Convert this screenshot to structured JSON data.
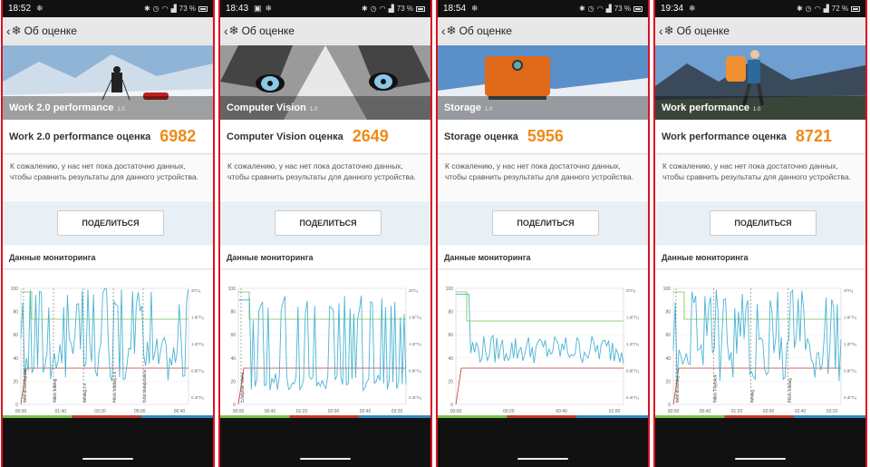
{
  "panels": [
    {
      "time": "18:52",
      "battery": "73 %",
      "appbar_title": "Об оценке",
      "hero_title": "Work 2.0 performance",
      "hero_version": "1.0",
      "score_label": "Work 2.0 performance оценка",
      "score_value": "6982",
      "message": "К сожалению, у нас нет пока достаточно данных, чтобы сравнить результаты для данного устройства.",
      "share_label": "ПОДЕЛИТЬСЯ",
      "monitoring_title": "Данные мониторинга",
      "y_left": [
        "100",
        "80",
        "60",
        "40",
        "20",
        "0"
      ],
      "y_right": [
        "2ГГц",
        "1.6ГГц",
        "1.2ГГц",
        "0.8ГГц",
        "0.4ГГц"
      ],
      "x_ticks": [
        "00:00",
        "01:40",
        "03:20",
        "05:00",
        "06:40"
      ],
      "markers": [
        "Web Browsing 2.0",
        "Video Editing",
        "Writing 2.0",
        "Photo Editing 2.0",
        "Data Manipulation"
      ]
    },
    {
      "time": "18:43",
      "battery": "73 %",
      "appbar_title": "Об оценке",
      "hero_title": "Computer Vision",
      "hero_version": "1.0",
      "score_label": "Computer Vision оценка",
      "score_value": "2649",
      "message": "К сожалению, у нас нет пока достаточно данных, чтобы сравнить результаты для данного устройства.",
      "share_label": "ПОДЕЛИТЬСЯ",
      "monitoring_title": "Данные мониторинга",
      "y_left": [
        "100",
        "80",
        "60",
        "40",
        "20",
        "0"
      ],
      "y_right": [
        "2ГГц",
        "1.6ГГц",
        "1.2ГГц",
        "0.8ГГц",
        "0.4ГГц"
      ],
      "x_ticks": [
        "00:00",
        "00:40",
        "01:20",
        "02:00",
        "02:40",
        "03:20"
      ],
      "markers": [
        "Computer Vision"
      ]
    },
    {
      "time": "18:54",
      "battery": "73 %",
      "appbar_title": "Об оценке",
      "hero_title": "Storage",
      "hero_version": "1.0",
      "score_label": "Storage оценка",
      "score_value": "5956",
      "message": "К сожалению, у нас нет пока достаточно данных, чтобы сравнить результаты для данного устройства.",
      "share_label": "ПОДЕЛИТЬСЯ",
      "monitoring_title": "Данные мониторинга",
      "y_left": [
        "100",
        "80",
        "60",
        "40",
        "20",
        "0"
      ],
      "y_right": [
        "2ГГц",
        "1.6ГГц",
        "1.2ГГц",
        "0.8ГГц",
        "0.4ГГц"
      ],
      "x_ticks": [
        "00:00",
        "00:20",
        "00:40",
        "01:00"
      ],
      "markers": []
    },
    {
      "time": "19:34",
      "battery": "72 %",
      "appbar_title": "Об оценке",
      "hero_title": "Work performance",
      "hero_version": "1.0",
      "score_label": "Work performance оценка",
      "score_value": "8721",
      "message": "К сожалению, у нас нет пока достаточно данных, чтобы сравнить результаты для данного устройства.",
      "share_label": "ПОДЕЛИТЬСЯ",
      "monitoring_title": "Данные мониторинга",
      "y_left": [
        "100",
        "80",
        "60",
        "40",
        "20",
        "0"
      ],
      "y_right": [
        "2ГГц",
        "1.6ГГц",
        "1.2ГГц",
        "0.8ГГц",
        "0.4ГГц"
      ],
      "x_ticks": [
        "00:00",
        "00:40",
        "01:20",
        "02:00",
        "02:40",
        "03:20"
      ],
      "markers": [
        "Web Browsing",
        "Video Playback",
        "Writing",
        "Photo Editing"
      ]
    }
  ],
  "icons": {
    "back": "chevron-left-icon",
    "logo": "snowflake-icon",
    "status": [
      "image-icon",
      "snowflake-icon",
      "bluetooth-icon",
      "alarm-icon",
      "wifi-icon",
      "signal-icon",
      "battery-icon"
    ]
  },
  "colors": {
    "score": "#f08a18",
    "series": "#4ab4d4",
    "green": "#7ac143",
    "red": "#c0392b",
    "panel_border": "#dd1122"
  }
}
